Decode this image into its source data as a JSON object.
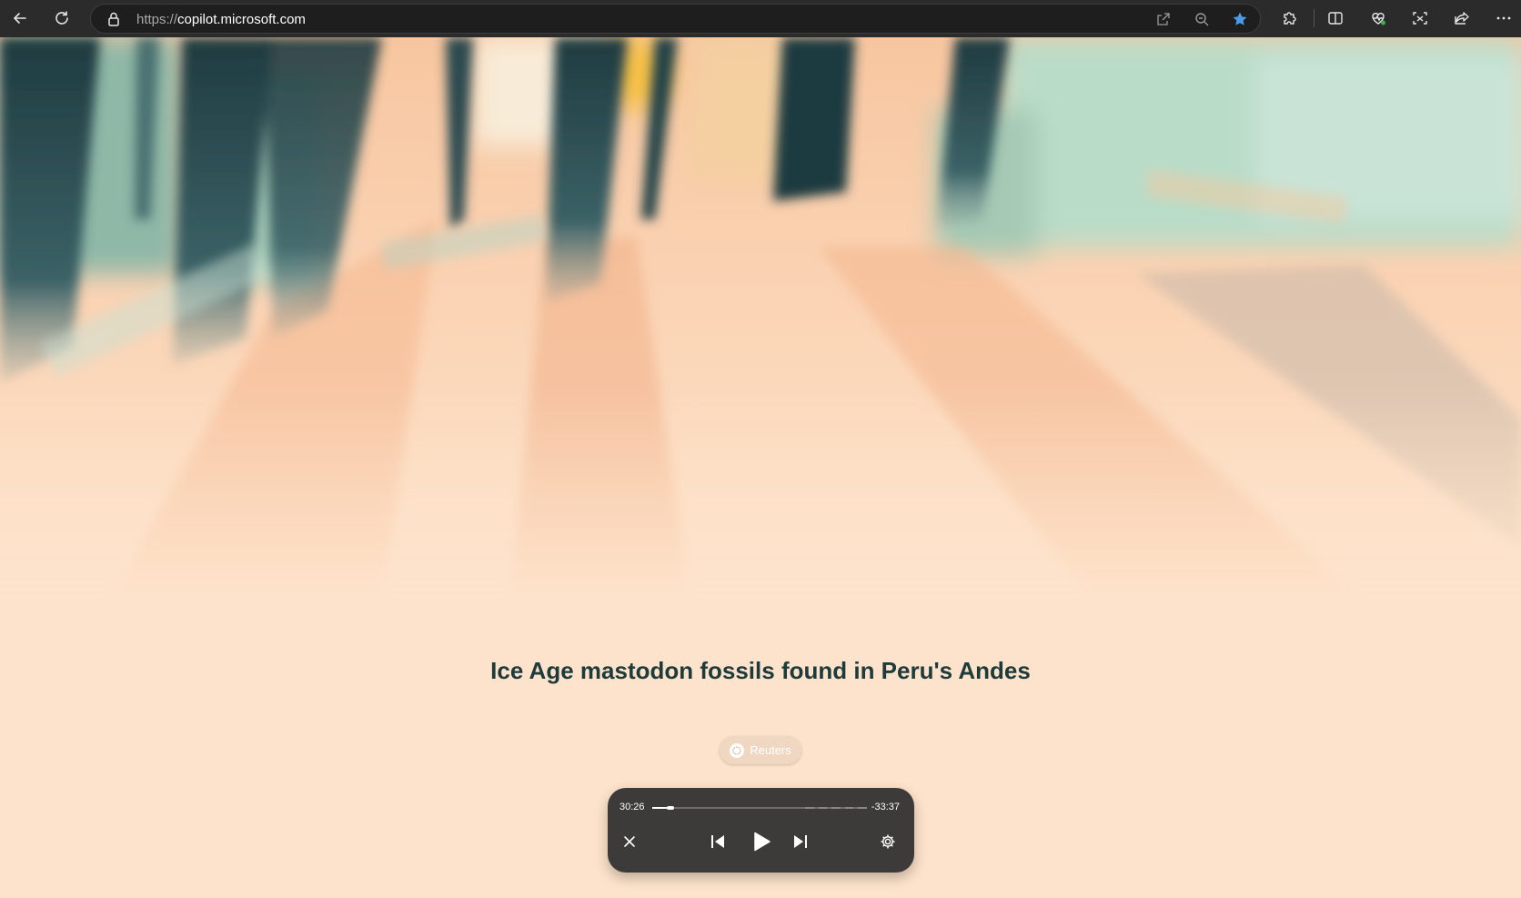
{
  "browser": {
    "url_protocol": "https://",
    "url_host": "copilot.microsoft.com",
    "icons": {
      "back": "back-arrow-icon",
      "refresh": "refresh-icon",
      "lock": "lock-icon",
      "open_app": "open-in-app-icon",
      "zoom": "zoom-out-icon",
      "favorite": "star-icon",
      "extensions": "puzzle-icon",
      "split": "split-screen-icon",
      "health": "browser-essentials-icon",
      "screenshot": "screenshot-icon",
      "share": "share-icon",
      "more": "more-icon"
    },
    "accent_color": "#4c9be8"
  },
  "story": {
    "headline": "Ice Age mastodon fossils found in Peru's Andes",
    "source": "Reuters"
  },
  "player": {
    "elapsed": "30:26",
    "remaining": "-33:37",
    "progress_fraction": 0.07,
    "controls": [
      "close-icon",
      "previous-icon",
      "play-icon",
      "next-icon",
      "settings-icon"
    ]
  }
}
